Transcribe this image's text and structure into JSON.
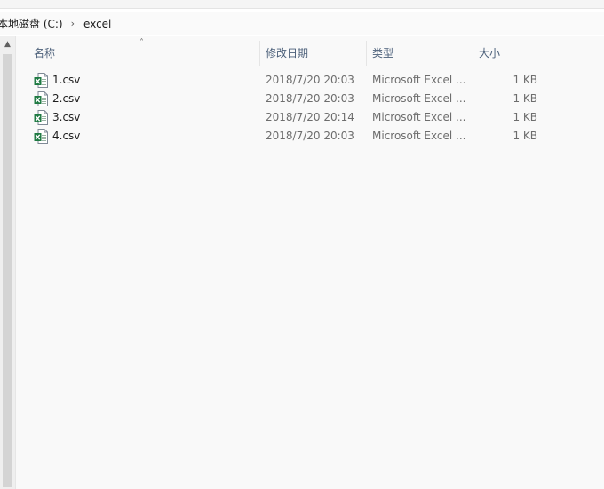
{
  "address": {
    "crumbs": [
      "本地磁盘 (C:)",
      "excel"
    ],
    "separator_icon": "chevron-right-icon"
  },
  "columns": {
    "name": "名称",
    "modified": "修改日期",
    "type": "类型",
    "size": "大小",
    "sort_icon": "sort-ascending-icon"
  },
  "files": [
    {
      "name": "1.csv",
      "modified": "2018/7/20 20:03",
      "type": "Microsoft Excel ...",
      "size": "1 KB"
    },
    {
      "name": "2.csv",
      "modified": "2018/7/20 20:03",
      "type": "Microsoft Excel ...",
      "size": "1 KB"
    },
    {
      "name": "3.csv",
      "modified": "2018/7/20 20:14",
      "type": "Microsoft Excel ...",
      "size": "1 KB"
    },
    {
      "name": "4.csv",
      "modified": "2018/7/20 20:03",
      "type": "Microsoft Excel ...",
      "size": "1 KB"
    }
  ],
  "colors": {
    "excel_green": "#1f7a43",
    "header_text": "#4c607a"
  }
}
